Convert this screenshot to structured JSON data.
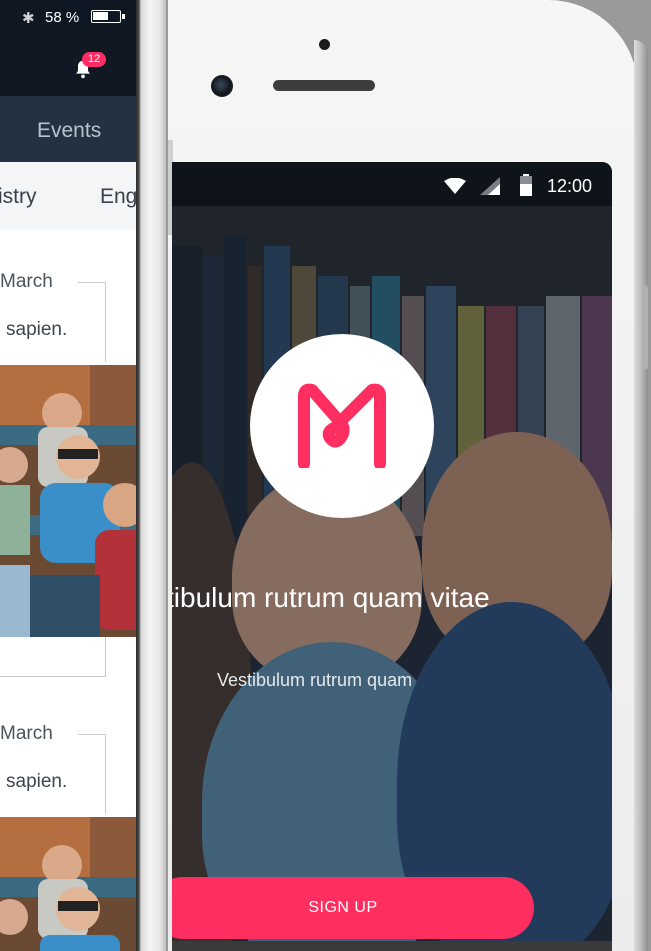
{
  "left_phone": {
    "status": {
      "bluetooth_icon": "bluetooth-icon",
      "battery_text": "58 %"
    },
    "nav": {
      "badge": "12",
      "bell_icon": "bell-icon"
    },
    "tabs": {
      "events": "Events"
    },
    "subtabs": [
      "istry",
      "Eng"
    ],
    "cards": [
      {
        "date": "March",
        "text": "sapien."
      },
      {
        "date": "March",
        "text": "sapien."
      }
    ]
  },
  "right_phone": {
    "status": {
      "time": "12:00",
      "wifi_icon": "wifi-icon",
      "signal_icon": "signal-icon",
      "battery_icon": "battery-icon"
    },
    "logo_icon": "m-logo-icon",
    "headline": "stibulum rutrum quam vitae",
    "subline": "Vestibulum rutrum quam",
    "signup_label": "SIGN UP"
  },
  "colors": {
    "accent": "#ff2e60",
    "dark_nav": "#101923",
    "tab_bar": "#233242"
  }
}
